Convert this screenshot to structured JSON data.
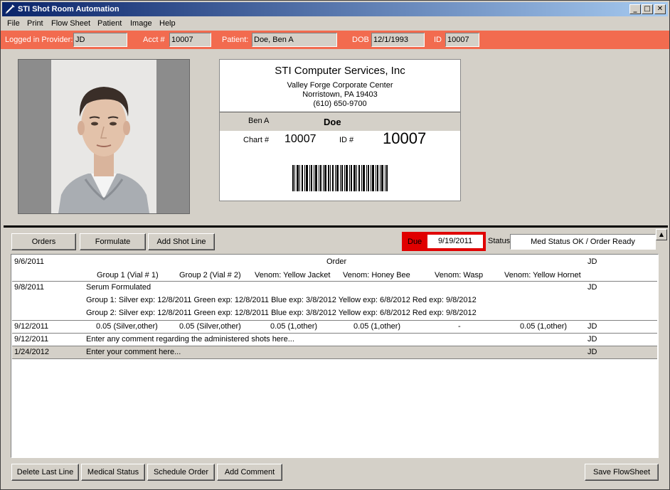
{
  "window": {
    "title": "STI Shot Room Automation",
    "minimize": "_",
    "maximize": "□",
    "close": "✕"
  },
  "menu": [
    "File",
    "Print",
    "Flow Sheet",
    "Patient",
    "Image",
    "Help"
  ],
  "infobar": {
    "provider_label": "Logged in Provider:",
    "provider": "JD",
    "acct_label": "Acct #",
    "acct": "10007",
    "patient_label": "Patient:",
    "patient": "Doe, Ben A",
    "dob_label": "DOB",
    "dob": "12/1/1993",
    "id_label": "ID",
    "id": "10007"
  },
  "card": {
    "company": "STI Computer Services, Inc",
    "address1": "Valley Forge Corporate Center",
    "address2": "Norristown, PA 19403",
    "phone": "(610) 650-9700",
    "first_name": "Ben A",
    "last_name": "Doe",
    "chart_label": "Chart #",
    "chart_value": "10007",
    "id_label": "ID #",
    "id_value": "10007"
  },
  "toolbar": {
    "orders": "Orders",
    "formulate": "Formulate",
    "add_shot_line": "Add Shot Line"
  },
  "due": {
    "label": "Due",
    "value": "9/19/2011"
  },
  "status": {
    "label": "Status",
    "value": "Med Status OK / Order Ready"
  },
  "flowsheet": {
    "order_row": {
      "date": "9/6/2011",
      "title": "Order",
      "provider": "JD",
      "headers": [
        "Group 1 (Vial # 1)",
        "Group 2 (Vial # 2)",
        "Venom: Yellow Jacket",
        "Venom: Honey Bee",
        "Venom: Wasp",
        "Venom: Yellow Hornet"
      ]
    },
    "serum_row": {
      "date": "9/8/2011",
      "title": "Serum Formulated",
      "provider": "JD",
      "group1": "Group 1:   Silver exp: 12/8/2011  Green exp: 12/8/2011  Blue exp: 3/8/2012  Yellow exp: 6/8/2012  Red exp: 9/8/2012",
      "group2": "Group 2:   Silver exp: 12/8/2011  Green exp: 12/8/2011  Blue exp: 3/8/2012  Yellow exp: 6/8/2012  Red exp: 9/8/2012"
    },
    "shot_row": {
      "date": "9/12/2011",
      "provider": "JD",
      "values": [
        "0.05 (Silver,other)",
        "0.05 (Silver,other)",
        "0.05 (1,other)",
        "0.05 (1,other)",
        "-",
        "0.05 (1,other)"
      ]
    },
    "comment_row": {
      "date": "9/12/2011",
      "text": "Enter any comment regarding the administered shots here...",
      "provider": "JD"
    },
    "new_comment_row": {
      "date": "1/24/2012",
      "text": "Enter your comment here...",
      "provider": "JD"
    }
  },
  "bottom": {
    "delete_last_line": "Delete Last Line",
    "medical_status": "Medical Status",
    "schedule_order": "Schedule Order",
    "add_comment": "Add Comment",
    "save_flowsheet": "Save FlowSheet"
  }
}
